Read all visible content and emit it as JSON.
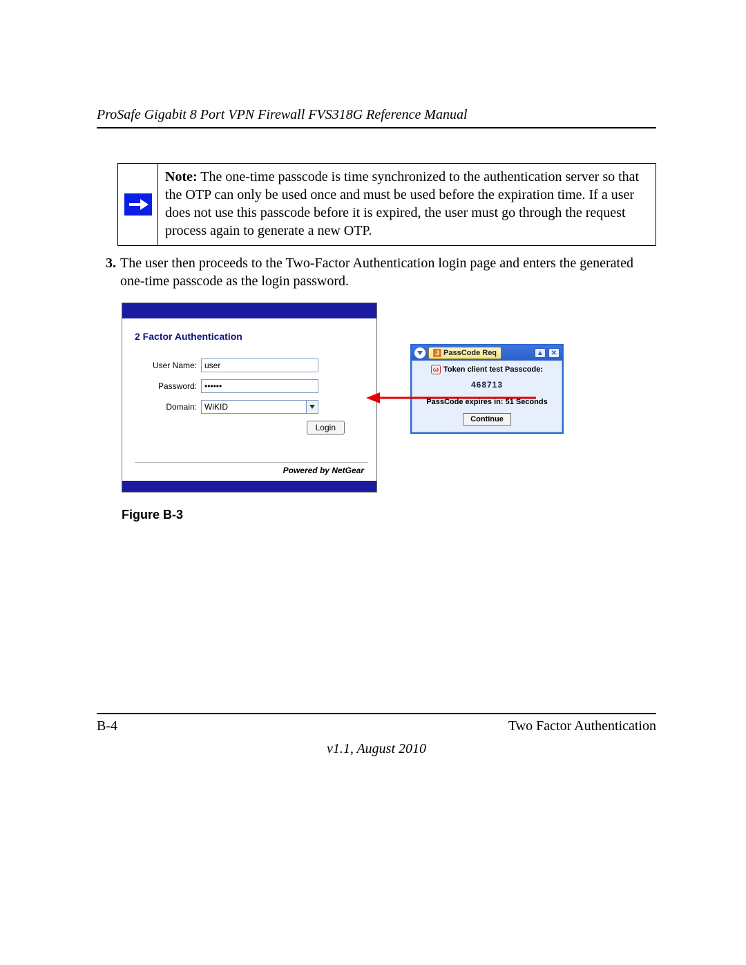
{
  "header": {
    "title": "ProSafe Gigabit 8 Port VPN Firewall FVS318G Reference Manual"
  },
  "note": {
    "label": "Note:",
    "text": "The one-time passcode is time synchronized to the authentication server so that the OTP can only be used once and must be used before the expiration time. If a user does not use this passcode before it is expired, the user must go through the request process again to generate a new OTP."
  },
  "step": {
    "number": "3.",
    "text": "The user then proceeds to the Two-Factor Authentication login page and enters the generated one-time passcode as the login password."
  },
  "login": {
    "title": "2 Factor Authentication",
    "labels": {
      "username": "User Name:",
      "password": "Password:",
      "domain": "Domain:"
    },
    "values": {
      "username": "user",
      "password": "••••••",
      "domain": "WiKID"
    },
    "button": "Login",
    "powered": "Powered by NetGear"
  },
  "passcode": {
    "title": "PassCode Req",
    "line1": "Token client test Passcode:",
    "code": "468713",
    "expires_prefix": "PassCode expires in:",
    "expires_value": "51 Seconds",
    "continue": "Continue"
  },
  "figure": {
    "caption": "Figure B-3"
  },
  "footer": {
    "page": "B-4",
    "section": "Two Factor Authentication",
    "version": "v1.1, August 2010"
  }
}
